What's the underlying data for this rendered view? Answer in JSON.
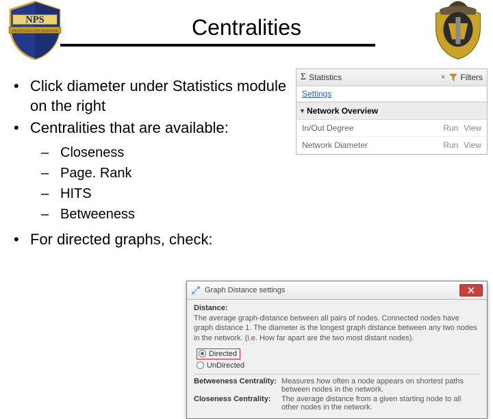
{
  "title": "Centralities",
  "bullets": {
    "b1": "Click diameter under Statistics module on the right",
    "b2": "Centralities that are available:",
    "sub": [
      "Closeness",
      "Page. Rank",
      "HITS",
      "Betweeness"
    ],
    "b3": "For directed graphs, check:"
  },
  "stats_panel": {
    "tab1": "Statistics",
    "tab2": "Filters",
    "close_x": "×",
    "settings": "Settings",
    "section": "Network Overview",
    "rows": [
      {
        "name": "In/Out Degree",
        "run": "Run",
        "view": "View"
      },
      {
        "name": "Network Diameter",
        "run": "Run",
        "view": "View"
      }
    ]
  },
  "dialog": {
    "title": "Graph Distance settings",
    "distance_label": "Distance:",
    "distance_desc": "The average graph-distance between all pairs of nodes. Connected nodes have graph distance 1. The diameter is the longest graph distance between any two nodes in the network. (i.e. How far apart are the two most distant nodes).",
    "opt_directed": "Directed",
    "opt_undirected": "UnDirected",
    "defs": [
      {
        "k": "Betweeness Centrality:",
        "v": "Measures how often a node appears on shortest paths between nodes in the network."
      },
      {
        "k": "Closeness Centrality:",
        "v": "The average distance from a given starting node to all other nodes in the network."
      }
    ]
  }
}
